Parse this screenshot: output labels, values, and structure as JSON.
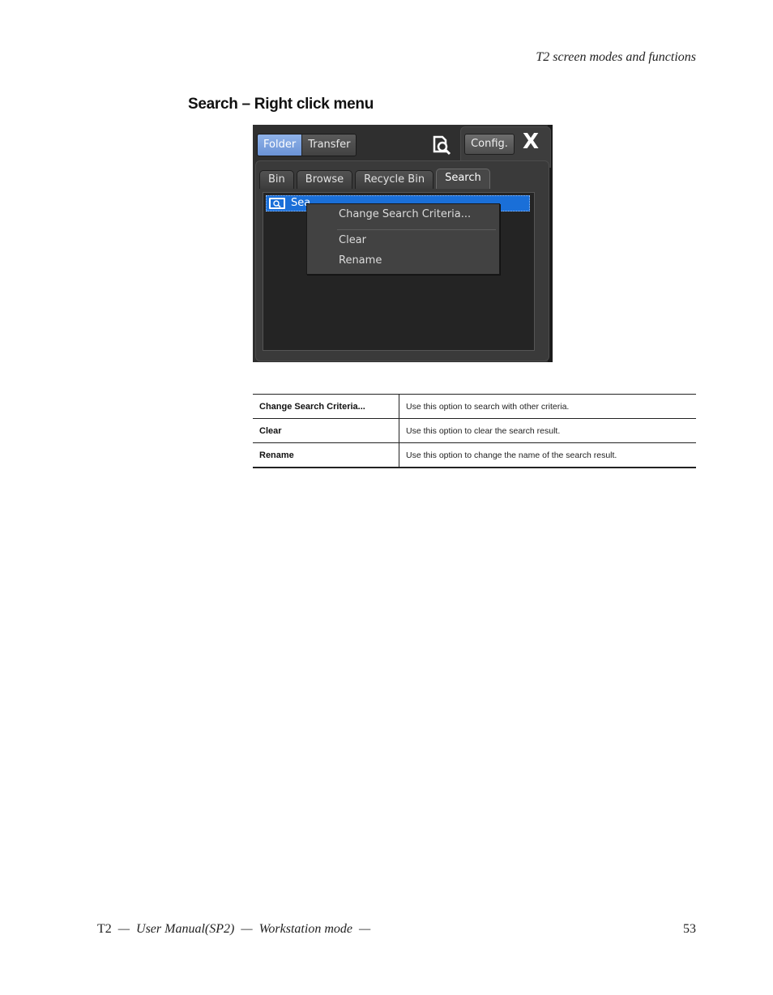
{
  "header": {
    "running_title": "T2 screen modes and functions"
  },
  "section": {
    "title": "Search – Right click menu"
  },
  "screenshot": {
    "toggle": {
      "folder": "Folder",
      "transfer": "Transfer"
    },
    "icons": {
      "search_tool": "search-document-icon",
      "close": "close-icon",
      "folder_search": "search-folder-icon"
    },
    "config_label": "Config.",
    "close_label": "X",
    "tabs": [
      "Bin",
      "Browse",
      "Recycle Bin",
      "Search"
    ],
    "active_tab": "Search",
    "list": {
      "selected_item_visible": "Sea"
    },
    "context_menu": {
      "items": [
        "Change Search Criteria...",
        "Clear",
        "Rename"
      ]
    },
    "colors": {
      "selection": "#1a6fd8",
      "active_toggle": "#7aa1e0",
      "panel_bg": "#2f2f2f"
    }
  },
  "table": {
    "rows": [
      {
        "term": "Change Search Criteria...",
        "desc": "Use this option to search with other criteria."
      },
      {
        "term": "Clear",
        "desc": "Use this option to clear the search result."
      },
      {
        "term": "Rename",
        "desc": "Use this option to change the name of the search result."
      }
    ]
  },
  "footer": {
    "product": "T2",
    "sep": "—",
    "manual": "User Manual(SP2)",
    "mode": "Workstation mode",
    "page_number": "53"
  }
}
